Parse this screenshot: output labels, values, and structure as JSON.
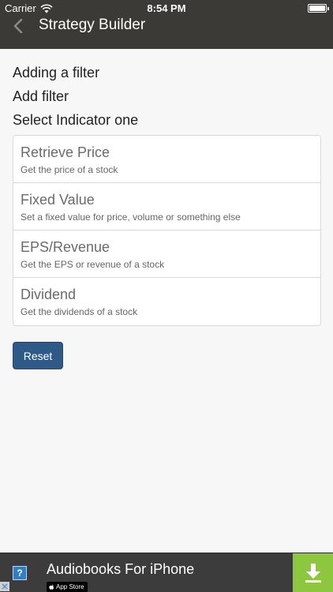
{
  "status_bar": {
    "carrier": "Carrier",
    "time": "8:54 PM"
  },
  "nav": {
    "title": "Strategy Builder"
  },
  "headings": [
    "Adding a filter",
    "Add filter",
    "Select Indicator one"
  ],
  "indicators": [
    {
      "title": "Retrieve Price",
      "description": "Get the price of a stock"
    },
    {
      "title": "Fixed Value",
      "description": "Set a fixed value for price, volume or something else"
    },
    {
      "title": "EPS/Revenue",
      "description": "Get the EPS or revenue of a stock"
    },
    {
      "title": "Dividend",
      "description": "Get the dividends of a stock"
    }
  ],
  "reset_label": "Reset",
  "ad": {
    "title": "Audiobooks For iPhone",
    "badge": "App Store",
    "help_glyph": "?"
  },
  "colors": {
    "nav_background": "#3b3a37",
    "button_primary": "#2f5a87",
    "download_green": "#8dc63f"
  }
}
